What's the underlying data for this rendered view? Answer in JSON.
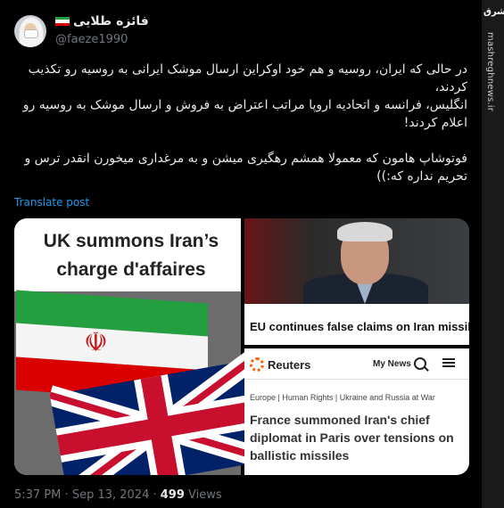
{
  "author": {
    "display_name": "فائزه طلایی",
    "handle": "@faeze1990"
  },
  "tweet": {
    "text": "در حالی که ایران، روسیه و هم خود اوکراین ارسال موشک ایرانی به روسیه رو تکذیب کردند،\nانگلیس، فرانسه و اتحادیه اروپا مراتب اعتراض به فروش و ارسال موشک به روسیه رو اعلام کردند!\n\nفوتوشاپ هامون که معمولا همشم رهگیری میشن و به مرغداری میخورن انقدر ترس و تحریم نداره که:))",
    "translate_label": "Translate post",
    "time": "5:37 PM",
    "separator": "·",
    "date": "Sep 13, 2024",
    "views_count": "499",
    "views_label": "Views"
  },
  "media": {
    "left_headline": "UK summons Iran’s charge d'affaires",
    "right_top_caption": "EU continues false claims on Iran missiles delivery to Russia",
    "reuters": {
      "logo_text": "Reuters",
      "nav_label": "My News",
      "categories": "Europe | Human Rights | Ukraine and Russia at War",
      "headline": "France summoned Iran's chief diplomat in Paris over tensions on ballistic missiles"
    }
  },
  "watermark": {
    "logo_text": "مشرق",
    "site": "mashreghnews.ir"
  },
  "colors": {
    "background": "#000000",
    "link": "#1d9bf0",
    "muted": "#71767b",
    "reuters_orange": "#fa6400"
  }
}
